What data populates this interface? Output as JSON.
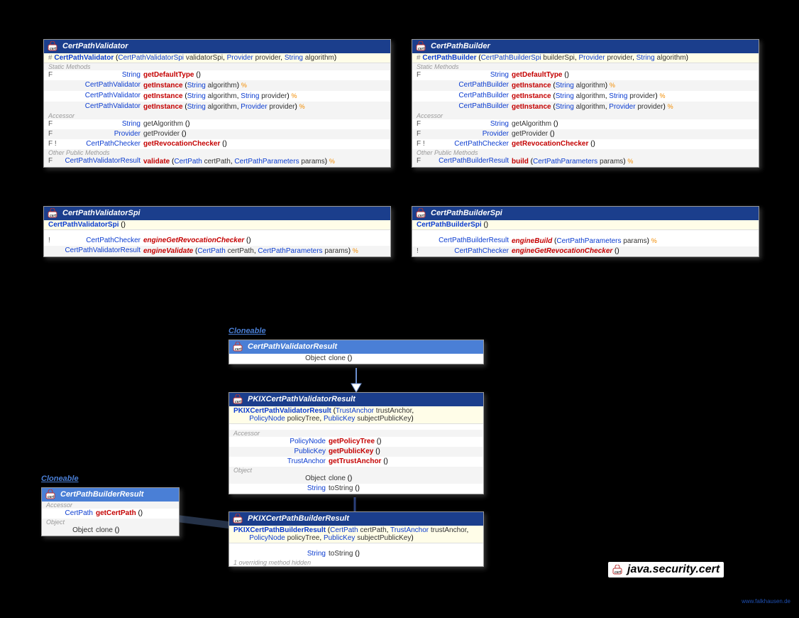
{
  "package": "java.security.cert",
  "credit": "www.falkhausen.de",
  "iface_labels": {
    "cloneable1": "Cloneable",
    "cloneable2": "Cloneable"
  },
  "boxes": {
    "cpv": {
      "title": "CertPathValidator",
      "ctor_prefix": "# ",
      "ctor": "CertPathValidator",
      "ctor_params": [
        {
          "t": "CertPathValidatorSpi",
          "n": "validatorSpi"
        },
        {
          "t": "Provider",
          "n": "provider"
        },
        {
          "t": "String",
          "n": "algorithm"
        }
      ],
      "sections": [
        {
          "label": "Static Methods",
          "rows": [
            {
              "mod": "F",
              "ret": "String",
              "name": "getDefaultType",
              "params": [],
              "em": false
            },
            {
              "mod": "",
              "ret": "CertPathValidator",
              "name": "getInstance",
              "params": [
                {
                  "t": "String",
                  "n": "algorithm"
                }
              ],
              "em": true
            },
            {
              "mod": "",
              "ret": "CertPathValidator",
              "name": "getInstance",
              "params": [
                {
                  "t": "String",
                  "n": "algorithm"
                },
                {
                  "t": "String",
                  "n": "provider"
                }
              ],
              "em": true
            },
            {
              "mod": "",
              "ret": "CertPathValidator",
              "name": "getInstance",
              "params": [
                {
                  "t": "String",
                  "n": "algorithm"
                },
                {
                  "t": "Provider",
                  "n": "provider"
                }
              ],
              "em": true
            }
          ]
        },
        {
          "label": "Accessor",
          "rows": [
            {
              "mod": "F",
              "ret": "String",
              "name": "getAlgorithm",
              "params": [],
              "em": false,
              "nrm": true
            },
            {
              "mod": "F",
              "ret": "Provider",
              "name": "getProvider",
              "params": [],
              "em": false,
              "nrm": true
            },
            {
              "mod": "F !",
              "ret": "CertPathChecker",
              "name": "getRevocationChecker",
              "params": [],
              "em": false
            }
          ]
        },
        {
          "label": "Other Public Methods",
          "rows": [
            {
              "mod": "F",
              "ret": "CertPathValidatorResult",
              "name": "validate",
              "params": [
                {
                  "t": "CertPath",
                  "n": "certPath"
                },
                {
                  "t": "CertPathParameters",
                  "n": "params"
                }
              ],
              "em": true
            }
          ]
        }
      ]
    },
    "cpvs": {
      "title": "CertPathValidatorSpi",
      "ctor": "CertPathValidatorSpi",
      "ctor_params": [],
      "rows": [
        {
          "mod": "!",
          "ret": "CertPathChecker",
          "name": "engineGetRevocationChecker",
          "params": [],
          "em": false,
          "it": true
        },
        {
          "mod": "",
          "ret": "CertPathValidatorResult",
          "name": "engineValidate",
          "params": [
            {
              "t": "CertPath",
              "n": "certPath"
            },
            {
              "t": "CertPathParameters",
              "n": "params"
            }
          ],
          "em": true,
          "it": true
        }
      ]
    },
    "cpb": {
      "title": "CertPathBuilder",
      "ctor_prefix": "# ",
      "ctor": "CertPathBuilder",
      "ctor_params": [
        {
          "t": "CertPathBuilderSpi",
          "n": "builderSpi"
        },
        {
          "t": "Provider",
          "n": "provider"
        },
        {
          "t": "String",
          "n": "algorithm"
        }
      ],
      "sections": [
        {
          "label": "Static Methods",
          "rows": [
            {
              "mod": "F",
              "ret": "String",
              "name": "getDefaultType",
              "params": [],
              "em": false
            },
            {
              "mod": "",
              "ret": "CertPathBuilder",
              "name": "getInstance",
              "params": [
                {
                  "t": "String",
                  "n": "algorithm"
                }
              ],
              "em": true
            },
            {
              "mod": "",
              "ret": "CertPathBuilder",
              "name": "getInstance",
              "params": [
                {
                  "t": "String",
                  "n": "algorithm"
                },
                {
                  "t": "String",
                  "n": "provider"
                }
              ],
              "em": true
            },
            {
              "mod": "",
              "ret": "CertPathBuilder",
              "name": "getInstance",
              "params": [
                {
                  "t": "String",
                  "n": "algorithm"
                },
                {
                  "t": "Provider",
                  "n": "provider"
                }
              ],
              "em": true
            }
          ]
        },
        {
          "label": "Accessor",
          "rows": [
            {
              "mod": "F",
              "ret": "String",
              "name": "getAlgorithm",
              "params": [],
              "em": false,
              "nrm": true
            },
            {
              "mod": "F",
              "ret": "Provider",
              "name": "getProvider",
              "params": [],
              "em": false,
              "nrm": true
            },
            {
              "mod": "F !",
              "ret": "CertPathChecker",
              "name": "getRevocationChecker",
              "params": [],
              "em": false
            }
          ]
        },
        {
          "label": "Other Public Methods",
          "rows": [
            {
              "mod": "F",
              "ret": "CertPathBuilderResult",
              "name": "build",
              "params": [
                {
                  "t": "CertPathParameters",
                  "n": "params"
                }
              ],
              "em": true
            }
          ]
        }
      ]
    },
    "cpbs": {
      "title": "CertPathBuilderSpi",
      "ctor": "CertPathBuilderSpi",
      "ctor_params": [],
      "rows": [
        {
          "mod": "",
          "ret": "CertPathBuilderResult",
          "name": "engineBuild",
          "params": [
            {
              "t": "CertPathParameters",
              "n": "params"
            }
          ],
          "em": true,
          "it": true
        },
        {
          "mod": "!",
          "ret": "CertPathChecker",
          "name": "engineGetRevocationChecker",
          "params": [],
          "em": false,
          "it": true
        }
      ]
    },
    "cpvr": {
      "title": "CertPathValidatorResult",
      "rows": [
        {
          "mod": "",
          "ret": "Object",
          "name": "clone",
          "params": [],
          "nrm": true
        }
      ]
    },
    "pkixvr": {
      "title": "PKIXCertPathValidatorResult",
      "ctor": "PKIXCertPathValidatorResult",
      "ctor_params_multi": [
        [
          {
            "t": "TrustAnchor",
            "n": "trustAnchor"
          }
        ],
        [
          {
            "t": "PolicyNode",
            "n": "policyTree"
          },
          {
            "t": "PublicKey",
            "n": "subjectPublicKey"
          }
        ]
      ],
      "sections": [
        {
          "label": "Accessor",
          "rows": [
            {
              "mod": "",
              "ret": "PolicyNode",
              "name": "getPolicyTree",
              "params": []
            },
            {
              "mod": "",
              "ret": "PublicKey",
              "name": "getPublicKey",
              "params": []
            },
            {
              "mod": "",
              "ret": "TrustAnchor",
              "name": "getTrustAnchor",
              "params": []
            }
          ]
        },
        {
          "label": "Object",
          "rows": [
            {
              "mod": "",
              "ret": "Object",
              "name": "clone",
              "params": [],
              "nrm": true
            },
            {
              "mod": "",
              "ret": "String",
              "name": "toString",
              "params": [],
              "nrm": true
            }
          ]
        }
      ]
    },
    "cpbr": {
      "title": "CertPathBuilderResult",
      "sections": [
        {
          "label": "Accessor",
          "rows": [
            {
              "mod": "",
              "ret": "CertPath",
              "name": "getCertPath",
              "params": []
            }
          ]
        },
        {
          "label": "Object",
          "rows": [
            {
              "mod": "",
              "ret": "Object",
              "name": "clone",
              "params": [],
              "nrm": true
            }
          ]
        }
      ]
    },
    "pkixbr": {
      "title": "PKIXCertPathBuilderResult",
      "ctor": "PKIXCertPathBuilderResult",
      "ctor_params_multi": [
        [
          {
            "t": "CertPath",
            "n": "certPath"
          },
          {
            "t": "TrustAnchor",
            "n": "trustAnchor"
          }
        ],
        [
          {
            "t": "PolicyNode",
            "n": "policyTree"
          },
          {
            "t": "PublicKey",
            "n": "subjectPublicKey"
          }
        ]
      ],
      "rows": [
        {
          "mod": "",
          "ret": "String",
          "name": "toString",
          "params": [],
          "nrm": true
        }
      ],
      "hidden": "1 overriding method hidden"
    }
  }
}
